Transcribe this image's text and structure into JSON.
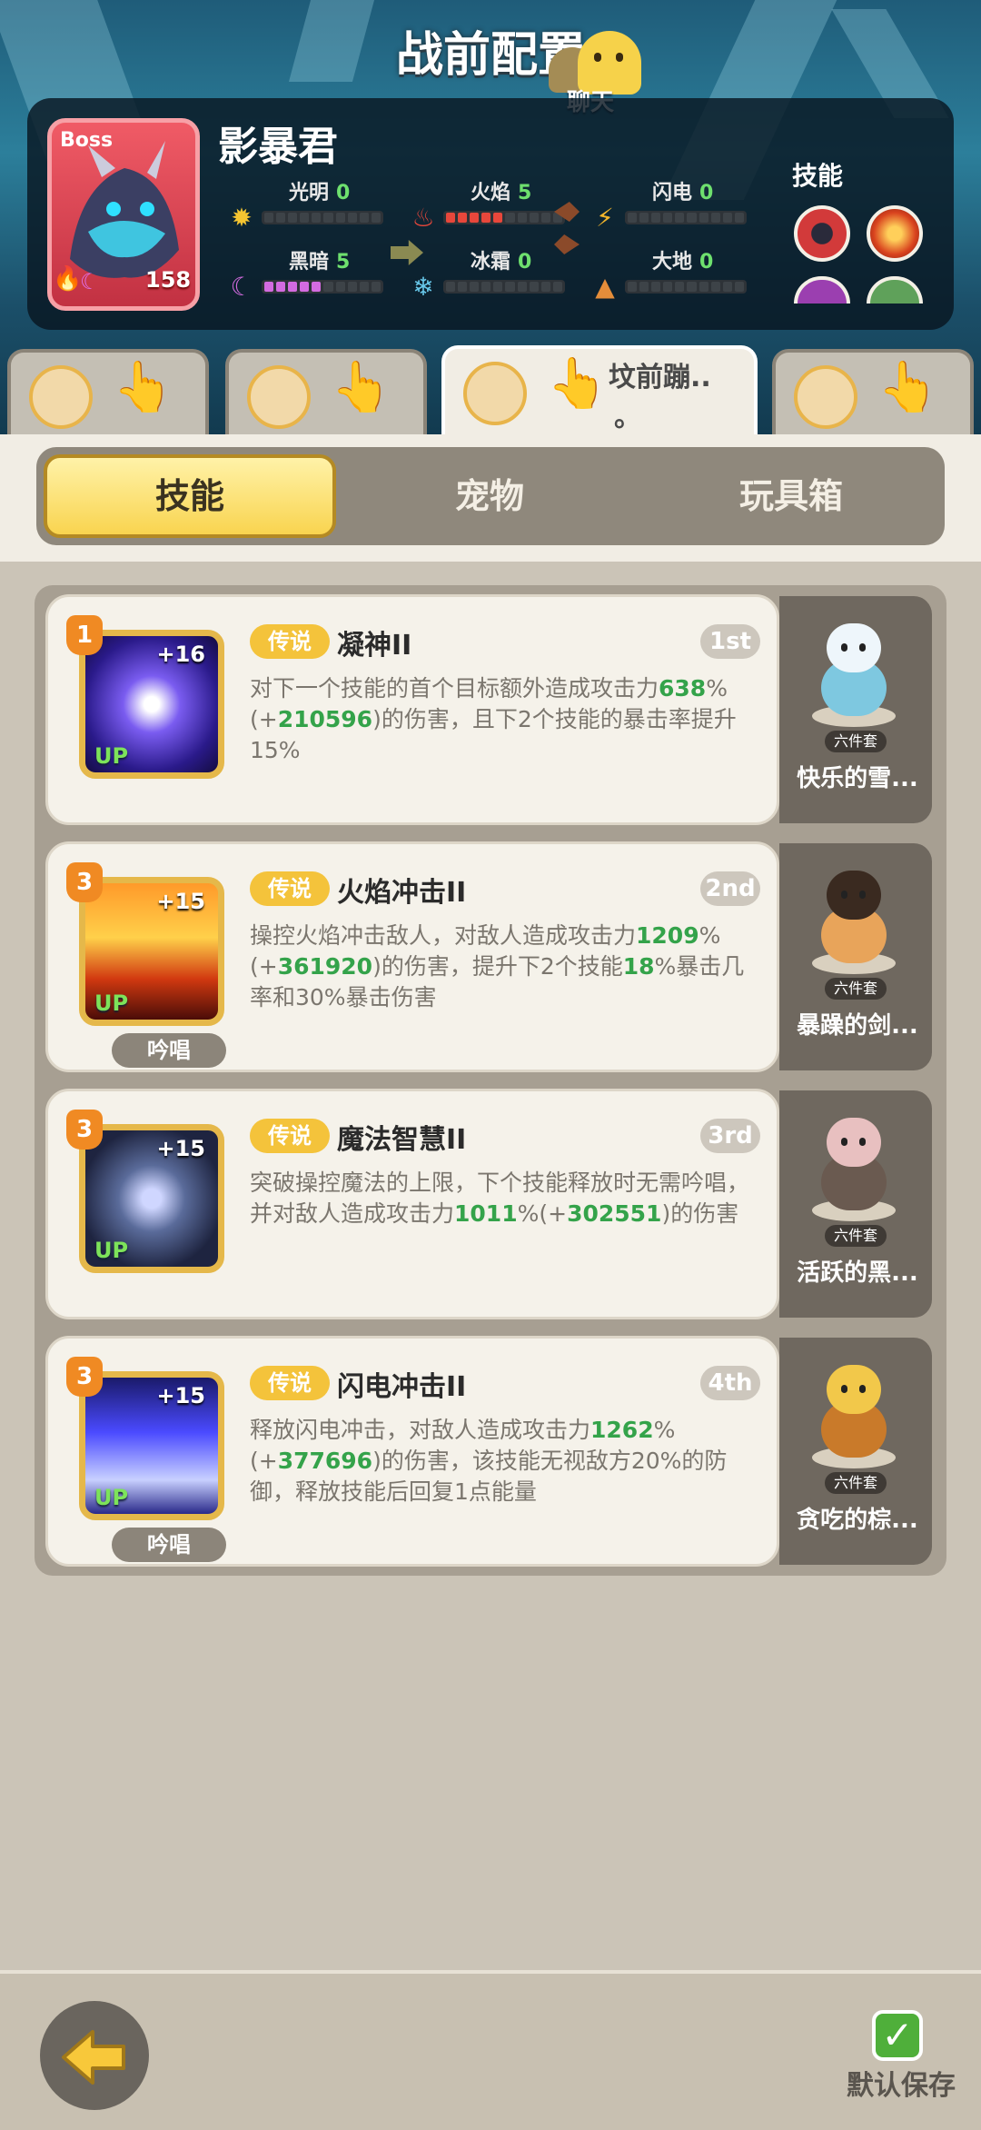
{
  "header": {
    "title": "战前配置",
    "chat_label": "聊天"
  },
  "boss": {
    "tag": "Boss",
    "level": "158",
    "name": "影暴君",
    "elements": [
      {
        "name": "光明",
        "value": "0",
        "icon": "sun-icon",
        "color": "#f5c531",
        "filled": 0
      },
      {
        "name": "火焰",
        "value": "5",
        "icon": "flame-icon",
        "color": "#e8473b",
        "filled": 5
      },
      {
        "name": "闪电",
        "value": "0",
        "icon": "lightning-icon",
        "color": "#f2b52b",
        "filled": 0
      },
      {
        "name": "黑暗",
        "value": "5",
        "icon": "moon-icon",
        "color": "#d46be0",
        "filled": 5
      },
      {
        "name": "冰霜",
        "value": "0",
        "icon": "snowflake-icon",
        "color": "#67c6e8",
        "filled": 0
      },
      {
        "name": "大地",
        "value": "0",
        "icon": "earth-icon",
        "color": "#e48d3a",
        "filled": 0
      }
    ],
    "skills_label": "技能"
  },
  "team_tabs": [
    {
      "name": ""
    },
    {
      "name": ""
    },
    {
      "name": "坟前蹦.."
    },
    {
      "name": ""
    }
  ],
  "tabs": {
    "skills": "技能",
    "pets": "宠物",
    "toybox": "玩具箱"
  },
  "skills": [
    {
      "level": "1",
      "plus": "+16",
      "up": "UP",
      "rarity": "传说",
      "name": "凝神II",
      "order": "1st",
      "desc": [
        {
          "t": "对下一个技能的首个目标额外造成攻击力"
        },
        {
          "t": "638",
          "g": true
        },
        {
          "t": "%(+"
        },
        {
          "t": "210596",
          "g": true
        },
        {
          "t": ")的伤害，且下2个技能的暴击率提升15%"
        }
      ],
      "chant": "",
      "pet_name": "快乐的雪...",
      "set_tag": "六件套"
    },
    {
      "level": "3",
      "plus": "+15",
      "up": "UP",
      "rarity": "传说",
      "name": "火焰冲击II",
      "order": "2nd",
      "desc": [
        {
          "t": "操控火焰冲击敌人，对敌人造成攻击力"
        },
        {
          "t": "1209",
          "g": true
        },
        {
          "t": "%(+"
        },
        {
          "t": "361920",
          "g": true
        },
        {
          "t": ")的伤害，提升下2个技能"
        },
        {
          "t": "18",
          "g": true
        },
        {
          "t": "%暴击几率和30%暴击伤害"
        }
      ],
      "chant": "吟唱",
      "pet_name": "暴躁的剑...",
      "set_tag": "六件套"
    },
    {
      "level": "3",
      "plus": "+15",
      "up": "UP",
      "rarity": "传说",
      "name": "魔法智慧II",
      "order": "3rd",
      "desc": [
        {
          "t": "突破操控魔法的上限，下个技能释放时无需吟唱，并对敌人造成攻击力"
        },
        {
          "t": "1011",
          "g": true
        },
        {
          "t": "%(+"
        },
        {
          "t": "302551",
          "g": true
        },
        {
          "t": ")的伤害"
        }
      ],
      "chant": "",
      "pet_name": "活跃的黑...",
      "set_tag": "六件套"
    },
    {
      "level": "3",
      "plus": "+15",
      "up": "UP",
      "rarity": "传说",
      "name": "闪电冲击II",
      "order": "4th",
      "desc": [
        {
          "t": "释放闪电冲击，对敌人造成攻击力"
        },
        {
          "t": "1262",
          "g": true
        },
        {
          "t": "%(+"
        },
        {
          "t": "377696",
          "g": true
        },
        {
          "t": ")的伤害，该技能无视敌方20%的防御，释放技能后回复1点能量"
        }
      ],
      "chant": "吟唱",
      "pet_name": "贪吃的棕...",
      "set_tag": "六件套"
    }
  ],
  "footer": {
    "save_label": "默认保存"
  }
}
